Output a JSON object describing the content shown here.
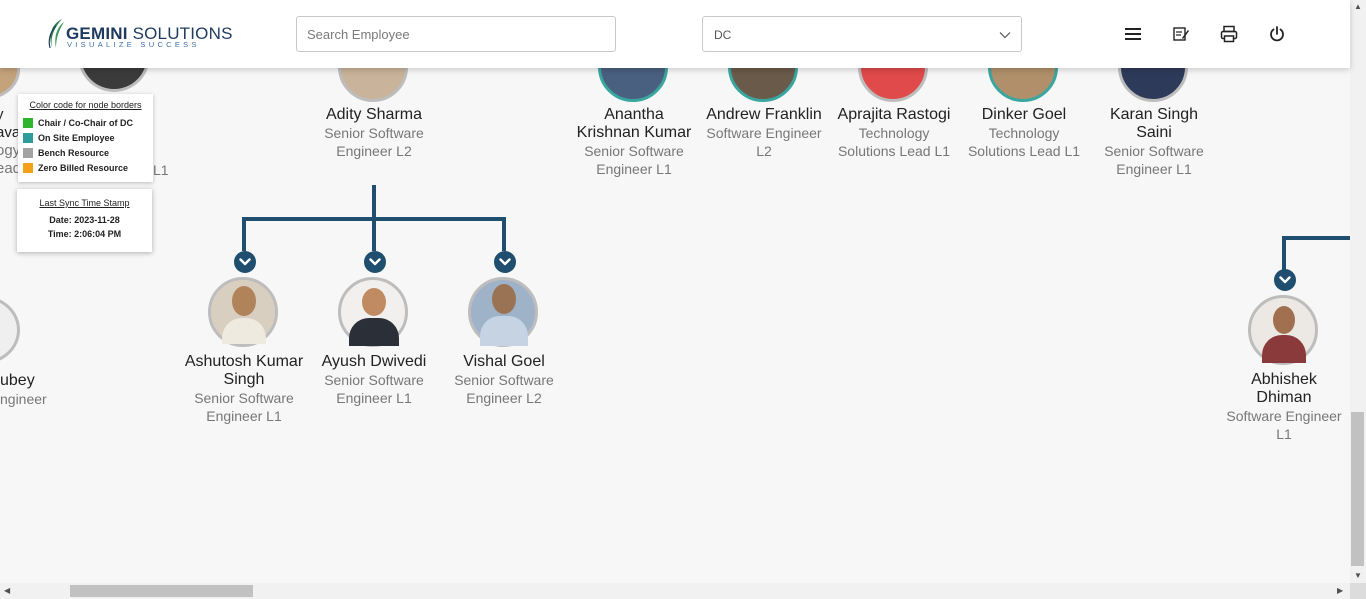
{
  "header": {
    "logo_line1_bold": "GEMINI",
    "logo_line1_rest": " SOLUTIONS",
    "logo_tagline": "VISUALIZE SUCCESS",
    "search_placeholder": "Search Employee",
    "department_select_value": "DC",
    "icons": [
      "menu-icon",
      "edit-note-icon",
      "print-icon",
      "power-icon"
    ]
  },
  "legend": {
    "title": "Color code for node borders",
    "items": [
      {
        "label": "Chair / Co-Chair of DC",
        "color": "#2db52d"
      },
      {
        "label": "On Site Employee",
        "color": "#2e9c9c"
      },
      {
        "label": "Bench Resource",
        "color": "#a3a3a3"
      },
      {
        "label": "Zero Billed Resource",
        "color": "#f4a11a"
      }
    ]
  },
  "sync": {
    "title": "Last Sync Time Stamp",
    "date": "Date: 2023-11-28",
    "time": "Time: 2:06:04 PM"
  },
  "partial_left": {
    "line1": "y",
    "line2": "ava",
    "line3": "ogy",
    "line4": "ead",
    "line5": "L1",
    "lower_name": "ubey",
    "lower_title": "ngineer"
  },
  "top_row": [
    {
      "name": "Adity Sharma",
      "title": "Senior Software Engineer L2"
    },
    {
      "name": "Anantha Krishnan Kumar",
      "title": "Senior Software Engineer L1"
    },
    {
      "name": "Andrew Franklin",
      "title": "Software Engineer L2"
    },
    {
      "name": "Aprajita Rastogi",
      "title": "Technology Solutions Lead L1"
    },
    {
      "name": "Dinker Goel",
      "title": "Technology Solutions Lead L1"
    },
    {
      "name": "Karan Singh Saini",
      "title": "Senior Software Engineer L1"
    }
  ],
  "children": [
    {
      "name": "Ashutosh Kumar Singh",
      "title": "Senior Software Engineer L1"
    },
    {
      "name": "Ayush Dwivedi",
      "title": "Senior Software Engineer L1"
    },
    {
      "name": "Vishal Goel",
      "title": "Senior Software Engineer L2"
    },
    {
      "name": "Abhishek Dhiman",
      "title": "Software Engineer L1"
    }
  ],
  "colors": {
    "connector": "#1f4e6e",
    "on_site_border": "#3aa6a0",
    "bench_border": "#bdbdbd"
  }
}
